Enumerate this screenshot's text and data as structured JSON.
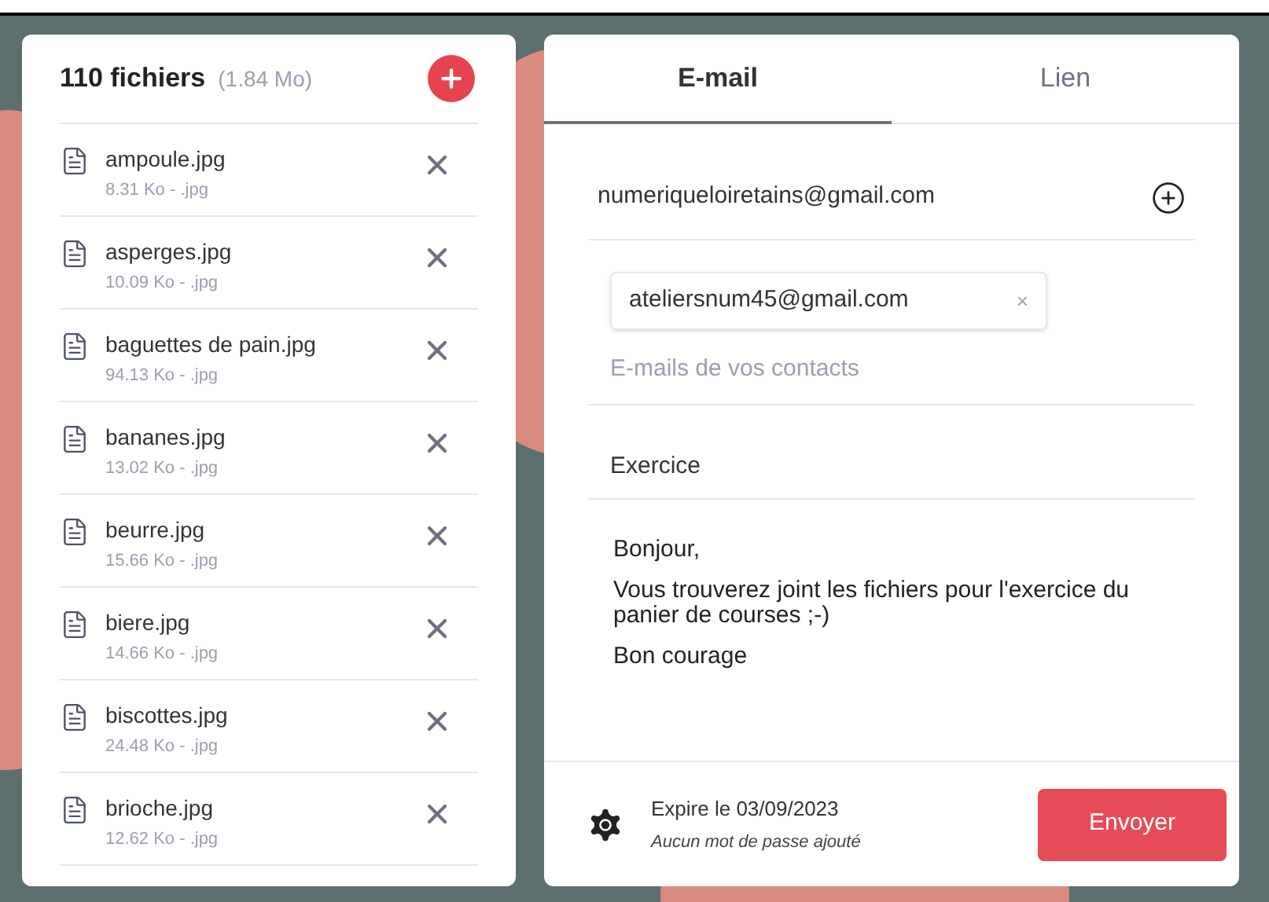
{
  "files_panel": {
    "title": "110 fichiers",
    "total_size": "(1.84 Mo)",
    "files": [
      {
        "name": "ampoule.jpg",
        "meta": "8.31 Ko - .jpg"
      },
      {
        "name": "asperges.jpg",
        "meta": "10.09 Ko - .jpg"
      },
      {
        "name": "baguettes de pain.jpg",
        "meta": "94.13 Ko - .jpg"
      },
      {
        "name": "bananes.jpg",
        "meta": "13.02 Ko - .jpg"
      },
      {
        "name": "beurre.jpg",
        "meta": "15.66 Ko - .jpg"
      },
      {
        "name": "biere.jpg",
        "meta": "14.66 Ko - .jpg"
      },
      {
        "name": "biscottes.jpg",
        "meta": "24.48 Ko - .jpg"
      },
      {
        "name": "brioche.jpg",
        "meta": "12.62 Ko - .jpg"
      }
    ]
  },
  "share_panel": {
    "tabs": [
      {
        "label": "E-mail",
        "selected": true
      },
      {
        "label": "Lien",
        "selected": false
      }
    ],
    "sender": {
      "value": "numeriqueloiretains@gmail.com"
    },
    "recipients": {
      "chips": [
        {
          "label": "ateliersnum45@gmail.com",
          "remove": "×"
        }
      ],
      "placeholder": "E-mails de vos contacts"
    },
    "subject": {
      "value": "Exercice"
    },
    "message": [
      "Bonjour,",
      "Vous trouverez joint les fichiers pour l'exercice du panier de courses ;-)",
      "Bon courage"
    ],
    "footer": {
      "expiry": "Expire le 03/09/2023",
      "password": "Aucun mot de passe ajouté",
      "send_button": "Envoyer"
    }
  }
}
